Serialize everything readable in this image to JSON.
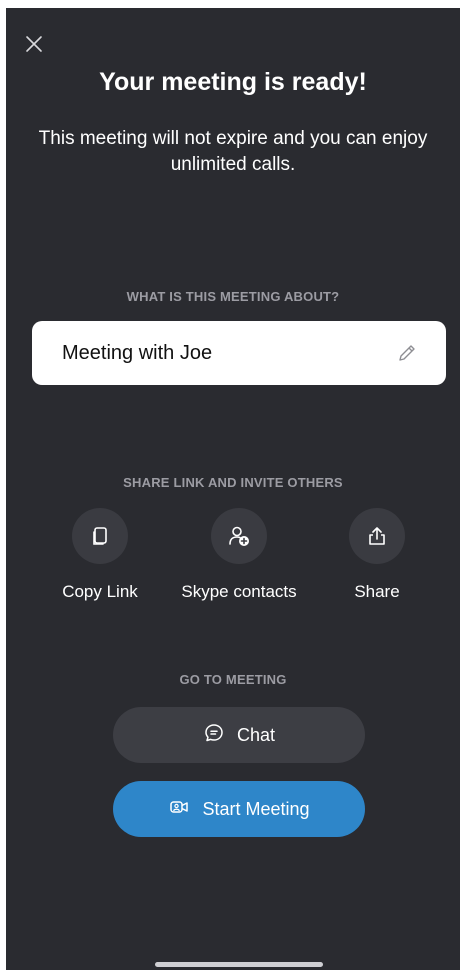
{
  "title": "Your meeting is ready!",
  "subtitle": "This meeting will not expire and you can enjoy unlimited calls.",
  "topic": {
    "label": "WHAT IS THIS MEETING ABOUT?",
    "value": "Meeting with Joe",
    "edit_icon": "pencil-icon"
  },
  "share": {
    "label": "SHARE LINK AND INVITE OTHERS",
    "items": [
      {
        "label": "Copy Link",
        "icon": "copy-icon"
      },
      {
        "label": "Skype contacts",
        "icon": "add-contact-icon"
      },
      {
        "label": "Share",
        "icon": "share-icon"
      }
    ]
  },
  "meeting": {
    "label": "GO TO MEETING",
    "chat_label": "Chat",
    "start_label": "Start Meeting"
  },
  "colors": {
    "background": "#2a2b30",
    "accent": "#2e86c9",
    "button_dark": "#3d3e44"
  }
}
